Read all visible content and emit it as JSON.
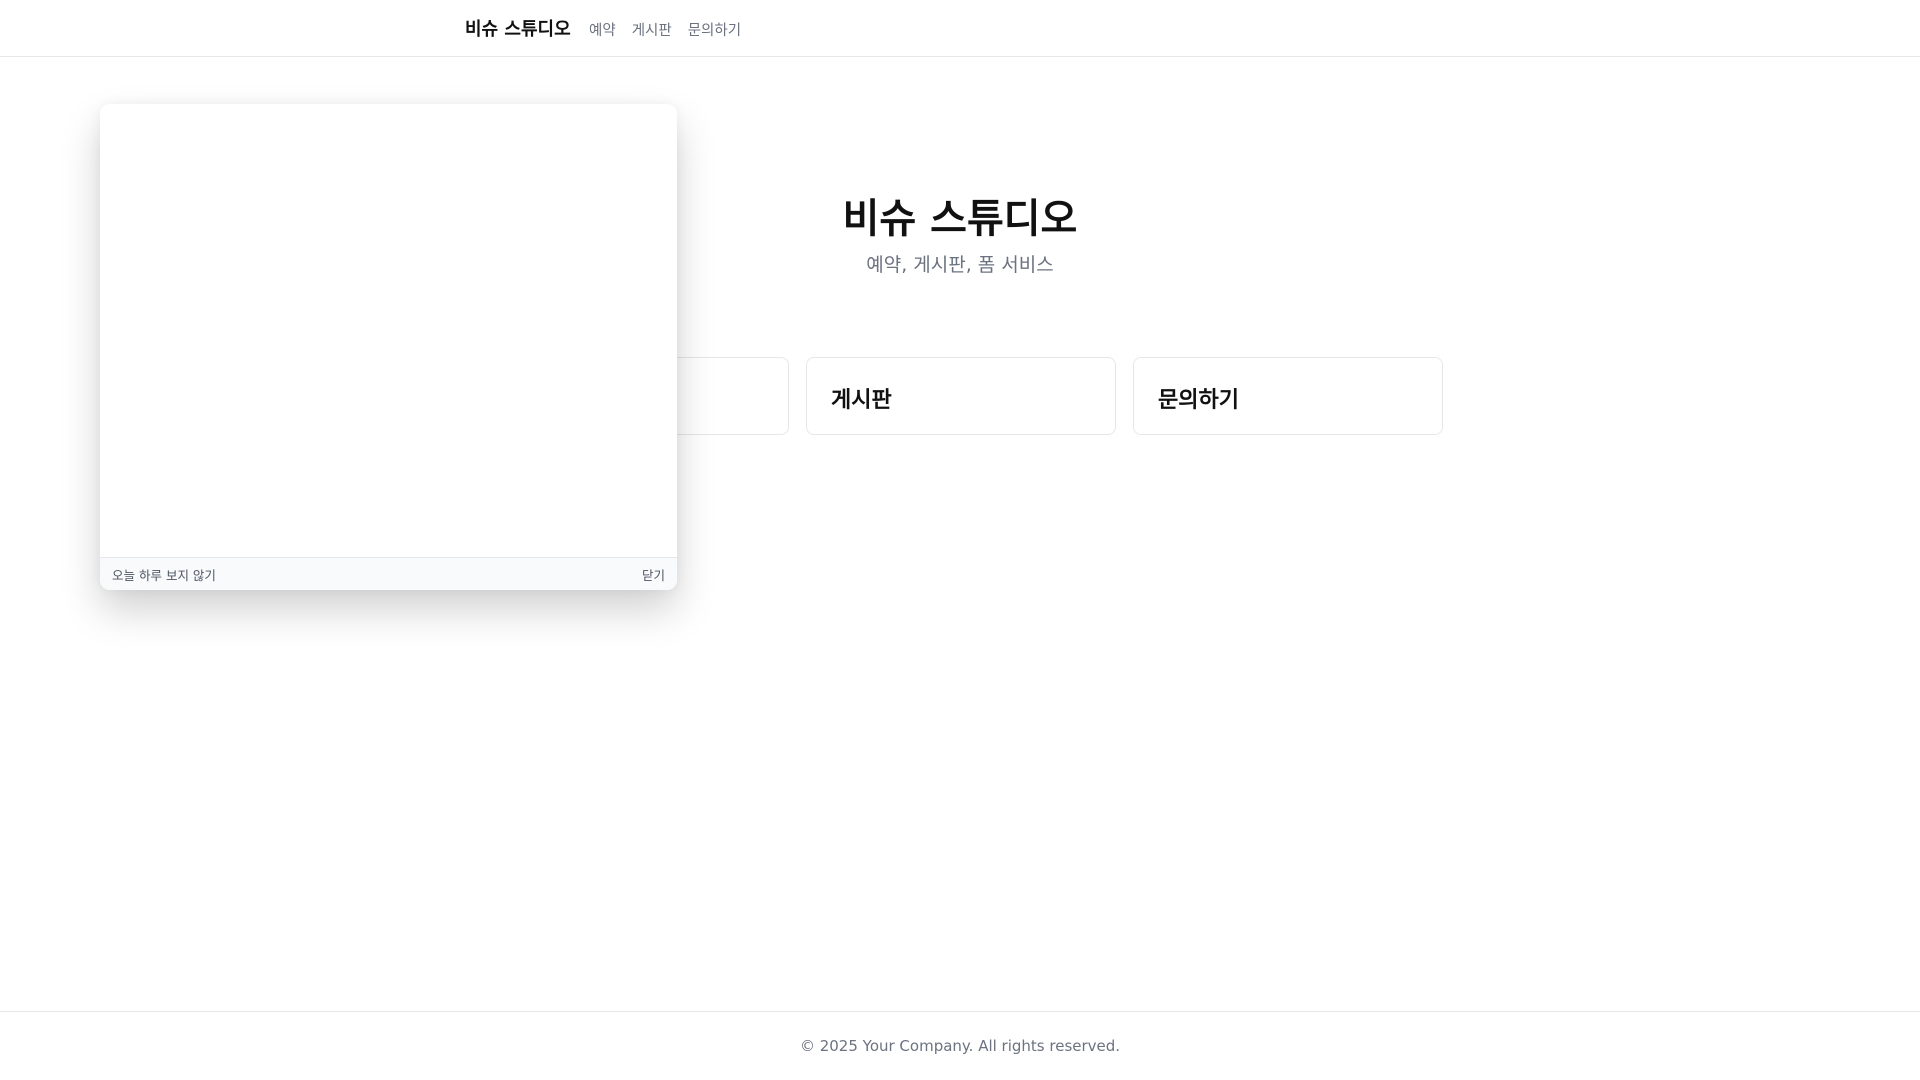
{
  "header": {
    "brand": "비슈 스튜디오",
    "nav": [
      "예약",
      "게시판",
      "문의하기"
    ]
  },
  "hero": {
    "title": "비슈 스튜디오",
    "subtitle": "예약, 게시판, 폼 서비스"
  },
  "cards": [
    "",
    "게시판",
    "문의하기"
  ],
  "popup": {
    "dont_show_today": "오늘 하루 보지 않기",
    "close": "닫기"
  },
  "footer": {
    "copyright": "© 2025 Your Company. All rights reserved."
  }
}
